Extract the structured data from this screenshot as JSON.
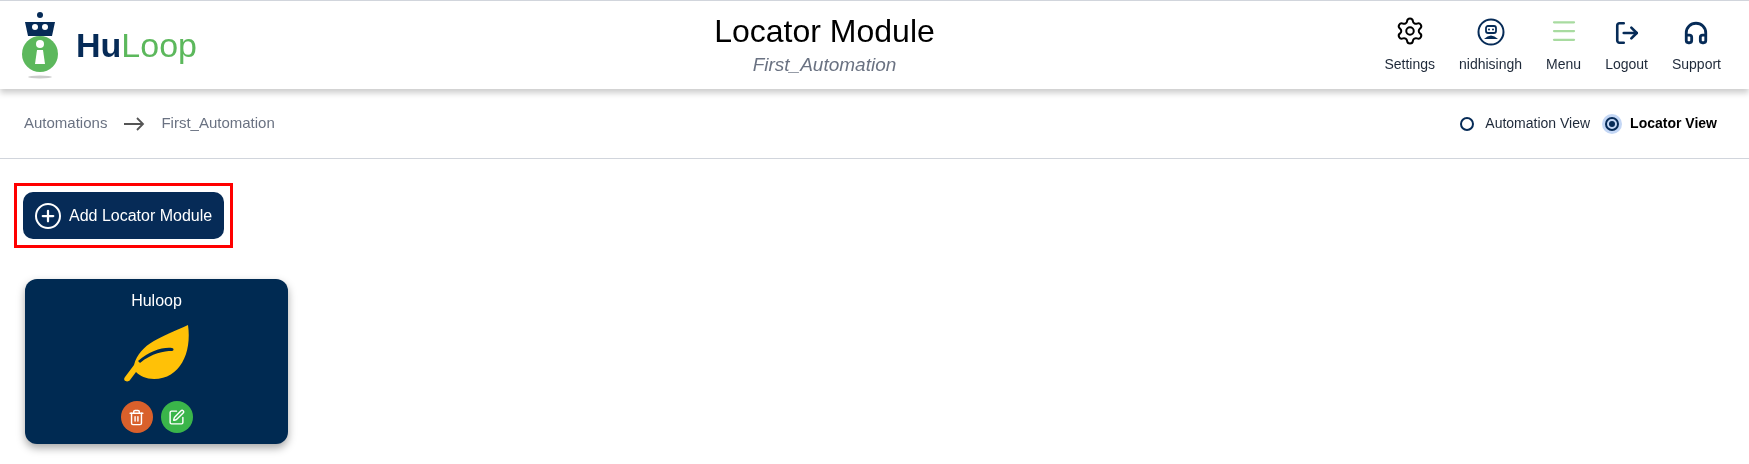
{
  "logo": {
    "first": "Hu",
    "second": "Loop"
  },
  "header": {
    "title": "Locator Module",
    "subtitle": "First_Automation"
  },
  "nav": [
    {
      "kind": "settings",
      "label": "Settings"
    },
    {
      "kind": "user",
      "label": "nidhisingh"
    },
    {
      "kind": "menu",
      "label": "Menu"
    },
    {
      "kind": "logout",
      "label": "Logout"
    },
    {
      "kind": "support",
      "label": "Support"
    }
  ],
  "breadcrumb": [
    {
      "label": "Automations"
    },
    {
      "label": "First_Automation"
    }
  ],
  "views": [
    {
      "label": "Automation View",
      "selected": false
    },
    {
      "label": "Locator View",
      "selected": true
    }
  ],
  "add_button": {
    "label": "Add Locator Module",
    "highlighted": true
  },
  "modules": [
    {
      "name": "Huloop"
    }
  ]
}
